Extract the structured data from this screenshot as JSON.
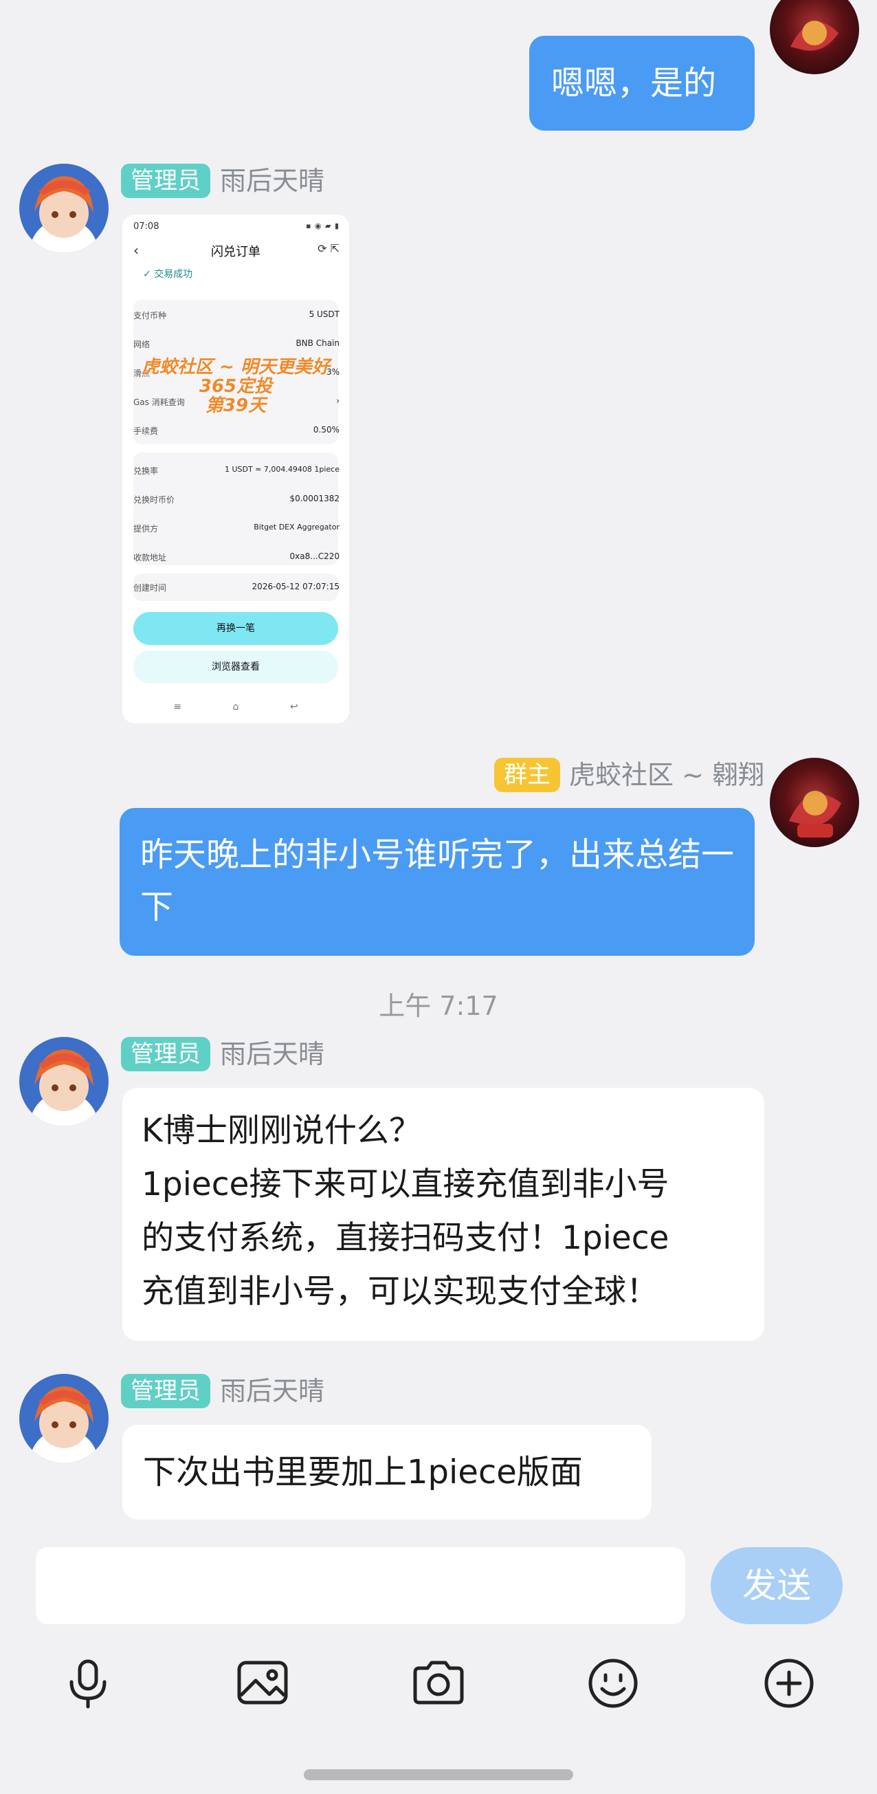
{
  "messages": {
    "m1": {
      "text": "嗯嗯，是的"
    },
    "m2": {
      "badge": "管理员",
      "sender": "雨后天晴"
    },
    "m3": {
      "badge": "群主",
      "sender": "虎蛟社区 ~ 翱翔",
      "text": "昨天晚上的非小号谁听完了，出来总结一下"
    },
    "time_divider": "上午 7:17",
    "m4": {
      "badge": "管理员",
      "sender": "雨后天晴",
      "lines": [
        "K博士刚刚说什么？",
        "1piece接下来可以直接充值到非小号",
        "的支付系统，直接扫码支付！1piece",
        "充值到非小号，可以实现支付全球！"
      ]
    },
    "m5": {
      "badge": "管理员",
      "sender": "雨后天晴",
      "text": "下次出书里要加上1piece版面"
    }
  },
  "screenshot": {
    "status_time": "07:08",
    "title": "闪兑订单",
    "status": "交易成功",
    "rows": [
      {
        "label": "支付币种",
        "value": "5 USDT"
      },
      {
        "label": "网络",
        "value": "BNB Chain"
      },
      {
        "label": "滑点",
        "value": "3%"
      },
      {
        "label": "Gas 消耗查询",
        "value": "›"
      },
      {
        "label": "手续费",
        "value": "0.50%"
      },
      {
        "label": "兑换率",
        "value": "1 USDT ≈ 7,004.49408 1piece"
      },
      {
        "label": "兑换时币价",
        "value": "$0.0001382"
      },
      {
        "label": "提供方",
        "value": "Bitget DEX Aggregator"
      },
      {
        "label": "收款地址",
        "value": "0xa8...C220"
      },
      {
        "label": "创建时间",
        "value": "2026-05-12 07:07:15"
      }
    ],
    "watermark": [
      "虎蛟社区 ~ 明天更美好",
      "365定投",
      "第39天"
    ],
    "btn_primary": "再换一笔",
    "btn_secondary": "浏览器查看"
  },
  "input": {
    "placeholder": "",
    "value": ""
  },
  "send_label": "发送",
  "toolbar_icons": [
    "microphone-icon",
    "image-icon",
    "camera-icon",
    "emoji-icon",
    "plus-icon"
  ],
  "colors": {
    "bubble_out": "#4a9bf3",
    "admin_badge": "#5fd0c6",
    "owner_badge": "#f7c534",
    "send_disabled": "#a9cff6"
  }
}
